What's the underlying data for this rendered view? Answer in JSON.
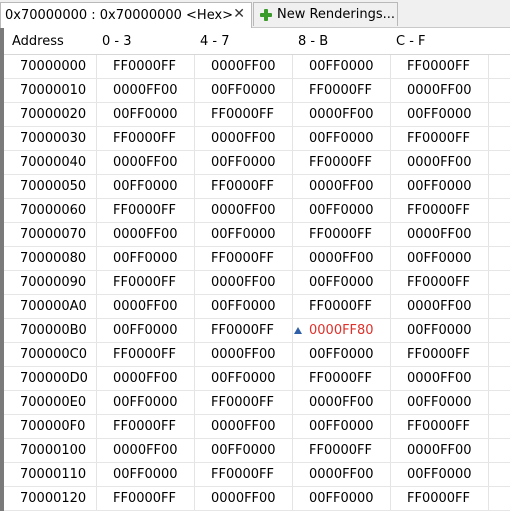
{
  "tabs": {
    "active_label": "0x70000000 : 0x70000000 <Hex>",
    "close_glyph": "✕",
    "inactive_label": "New Renderings...",
    "plus_icon": "plus-icon"
  },
  "table": {
    "headers": [
      "Address",
      "0 - 3",
      "4 - 7",
      "8 - B",
      "C - F"
    ],
    "changed_color": "#e0302a",
    "rows": [
      {
        "address": "70000000",
        "cells": [
          "FF0000FF",
          "0000FF00",
          "00FF0000",
          "FF0000FF"
        ]
      },
      {
        "address": "70000010",
        "cells": [
          "0000FF00",
          "00FF0000",
          "FF0000FF",
          "0000FF00"
        ]
      },
      {
        "address": "70000020",
        "cells": [
          "00FF0000",
          "FF0000FF",
          "0000FF00",
          "00FF0000"
        ]
      },
      {
        "address": "70000030",
        "cells": [
          "FF0000FF",
          "0000FF00",
          "00FF0000",
          "FF0000FF"
        ]
      },
      {
        "address": "70000040",
        "cells": [
          "0000FF00",
          "00FF0000",
          "FF0000FF",
          "0000FF00"
        ]
      },
      {
        "address": "70000050",
        "cells": [
          "00FF0000",
          "FF0000FF",
          "0000FF00",
          "00FF0000"
        ]
      },
      {
        "address": "70000060",
        "cells": [
          "FF0000FF",
          "0000FF00",
          "00FF0000",
          "FF0000FF"
        ]
      },
      {
        "address": "70000070",
        "cells": [
          "0000FF00",
          "00FF0000",
          "FF0000FF",
          "0000FF00"
        ]
      },
      {
        "address": "70000080",
        "cells": [
          "00FF0000",
          "FF0000FF",
          "0000FF00",
          "00FF0000"
        ]
      },
      {
        "address": "70000090",
        "cells": [
          "FF0000FF",
          "0000FF00",
          "00FF0000",
          "FF0000FF"
        ]
      },
      {
        "address": "700000A0",
        "cells": [
          "0000FF00",
          "00FF0000",
          "FF0000FF",
          "0000FF00"
        ]
      },
      {
        "address": "700000B0",
        "cells": [
          "00FF0000",
          "FF0000FF",
          "0000FF80",
          "00FF0000"
        ],
        "changed_cell": 2,
        "marker_icon": "delta-marker-icon"
      },
      {
        "address": "700000C0",
        "cells": [
          "FF0000FF",
          "0000FF00",
          "00FF0000",
          "FF0000FF"
        ]
      },
      {
        "address": "700000D0",
        "cells": [
          "0000FF00",
          "00FF0000",
          "FF0000FF",
          "0000FF00"
        ]
      },
      {
        "address": "700000E0",
        "cells": [
          "00FF0000",
          "FF0000FF",
          "0000FF00",
          "00FF0000"
        ]
      },
      {
        "address": "700000F0",
        "cells": [
          "FF0000FF",
          "0000FF00",
          "00FF0000",
          "FF0000FF"
        ]
      },
      {
        "address": "70000100",
        "cells": [
          "0000FF00",
          "00FF0000",
          "FF0000FF",
          "0000FF00"
        ]
      },
      {
        "address": "70000110",
        "cells": [
          "00FF0000",
          "FF0000FF",
          "0000FF00",
          "00FF0000"
        ]
      },
      {
        "address": "70000120",
        "cells": [
          "FF0000FF",
          "0000FF00",
          "00FF0000",
          "FF0000FF"
        ]
      }
    ]
  }
}
